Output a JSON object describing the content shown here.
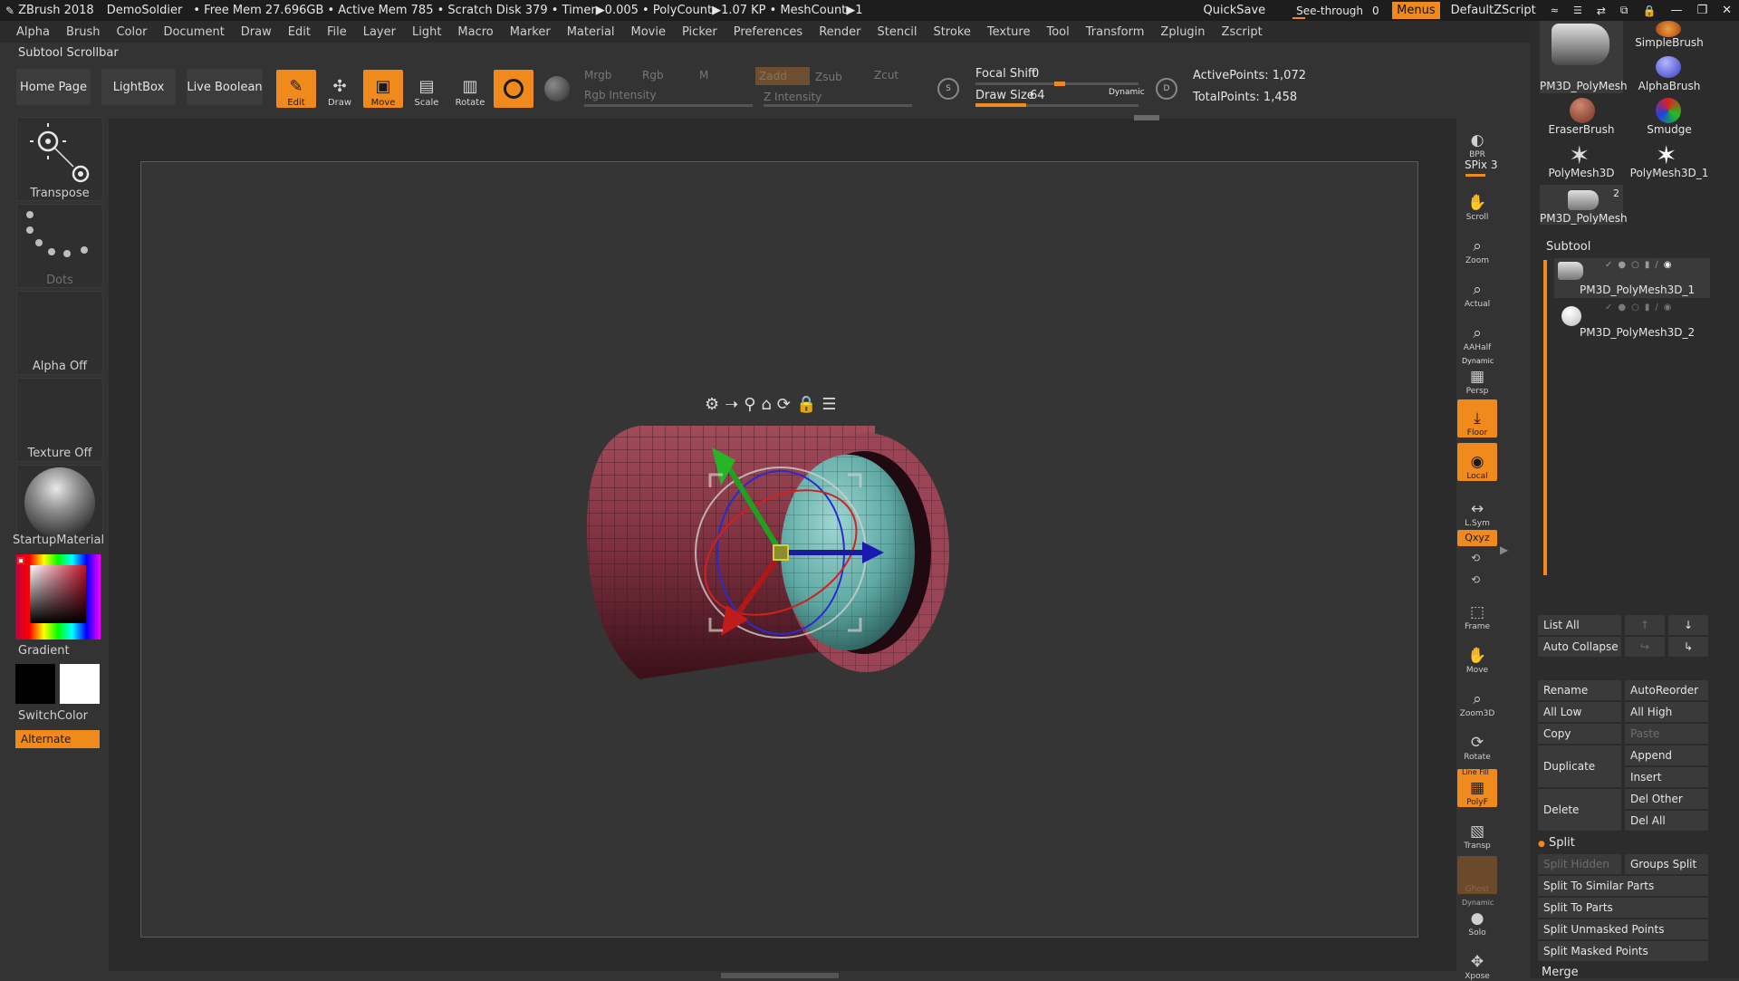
{
  "titlebar": {
    "app": "ZBrush 2018",
    "project": "DemoSoldier",
    "stats": "• Free Mem 27.696GB • Active Mem 785 • Scratch Disk 379 • Timer▶0.005 • PolyCount▶1.07 KP • MeshCount▶1",
    "quicksave": "QuickSave",
    "see_through_label": "See-through",
    "see_through_value": "0",
    "menus": "Menus",
    "zscript": "DefaultZScript"
  },
  "menubar": [
    "Alpha",
    "Brush",
    "Color",
    "Document",
    "Draw",
    "Edit",
    "File",
    "Layer",
    "Light",
    "Macro",
    "Marker",
    "Material",
    "Movie",
    "Picker",
    "Preferences",
    "Render",
    "Stencil",
    "Stroke",
    "Texture",
    "Tool",
    "Transform",
    "Zplugin",
    "Zscript"
  ],
  "subtool_scrollbar": "Subtool Scrollbar",
  "toolbar": {
    "home": "Home Page",
    "lightbox": "LightBox",
    "live_boolean": "Live Boolean",
    "edit": "Edit",
    "draw": "Draw",
    "move": "Move",
    "scale": "Scale",
    "rotate": "Rotate",
    "mrgb": "Mrgb",
    "rgb": "Rgb",
    "m": "M",
    "zadd": "Zadd",
    "zsub": "Zsub",
    "zcut": "Zcut",
    "rgb_intensity": "Rgb Intensity",
    "z_intensity": "Z Intensity",
    "focal_shift_label": "Focal Shift",
    "focal_shift_value": "0",
    "draw_size_label": "Draw Size",
    "draw_size_value": "64",
    "dynamic": "Dynamic",
    "active_points": "ActivePoints: 1,072",
    "total_points": "TotalPoints: 1,458"
  },
  "left_shelf": {
    "transpose": "Transpose",
    "dots": "Dots",
    "alpha": "Alpha Off",
    "texture": "Texture Off",
    "material": "StartupMaterial",
    "gradient": "Gradient",
    "switch_color": "SwitchColor",
    "alternate": "Alternate"
  },
  "right_shelf": {
    "bpr": "BPR",
    "spix": "SPix 3",
    "scroll": "Scroll",
    "zoom": "Zoom",
    "actual": "Actual",
    "aahalf": "AAHalf",
    "dynamic": "Dynamic",
    "persp": "Persp",
    "floor": "Floor",
    "local": "Local",
    "lsym": "L.Sym",
    "xyz": "Qxyz",
    "frame": "Frame",
    "move": "Move",
    "zoom3d": "Zoom3D",
    "rotate": "Rotate",
    "linefill": "Line Fill",
    "polyf": "PolyF",
    "transp": "Transp",
    "ghost": "Ghost",
    "dynamic2": "Dynamic",
    "solo": "Solo",
    "xpose": "Xpose"
  },
  "tool_palette": {
    "thumbs": [
      {
        "label": "PM3D_PolyMesh"
      },
      {
        "label": "SimpleBrush"
      },
      {
        "label": "AlphaBrush"
      },
      {
        "label": "EraserBrush"
      },
      {
        "label": "Smudge"
      },
      {
        "label": "PolyMesh3D"
      },
      {
        "label": "PolyMesh3D_1"
      },
      {
        "label": "PM3D_PolyMesh"
      }
    ],
    "thumb_count": "2",
    "subtool_header": "Subtool",
    "subtools": [
      "PM3D_PolyMesh3D_1",
      "PM3D_PolyMesh3D_2"
    ],
    "list_all": "List All",
    "auto_collapse": "Auto Collapse",
    "rename": "Rename",
    "autoreorder": "AutoReorder",
    "all_low": "All Low",
    "all_high": "All High",
    "copy": "Copy",
    "paste": "Paste",
    "duplicate": "Duplicate",
    "append": "Append",
    "insert": "Insert",
    "delete": "Delete",
    "del_other": "Del Other",
    "del_all": "Del All",
    "split": "Split",
    "split_hidden": "Split Hidden",
    "groups_split": "Groups Split",
    "split_similar": "Split To Similar Parts",
    "split_parts": "Split To Parts",
    "split_unmasked": "Split Unmasked Points",
    "split_masked": "Split Masked Points",
    "merge": "Merge"
  },
  "colors": {
    "accent": "#f08a1c",
    "mesh_red": "#8e3a4a",
    "mesh_teal": "#6fb8b3"
  }
}
